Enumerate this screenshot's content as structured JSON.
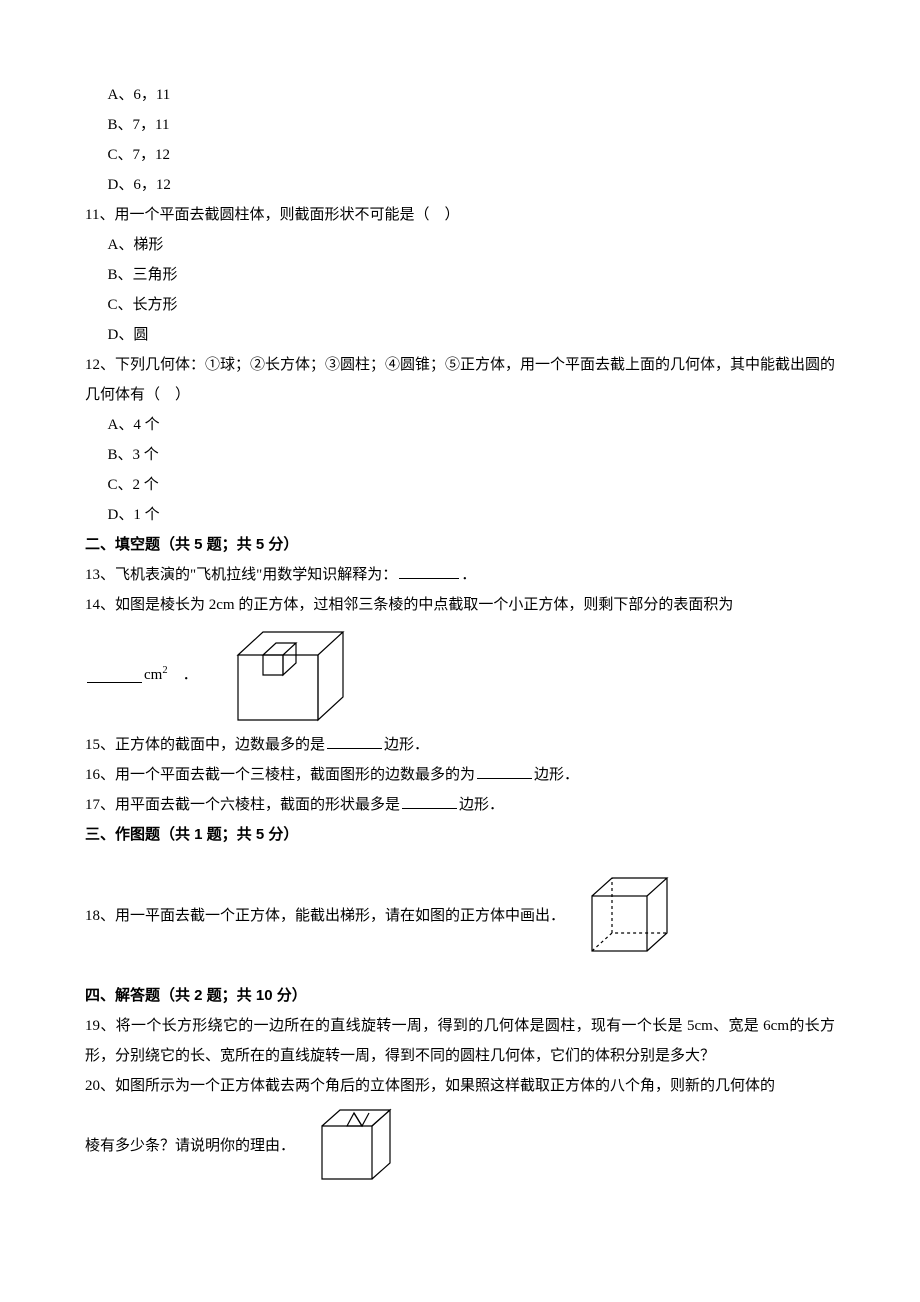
{
  "q10_options": {
    "a": "A、6，11",
    "b": "B、7，11",
    "c": "C、7，12",
    "d": "D、6，12"
  },
  "q11": {
    "text": "11、用一个平面去截圆柱体，则截面形状不可能是（　）",
    "a": "A、梯形",
    "b": "B、三角形",
    "c": "C、长方形",
    "d": "D、圆"
  },
  "q12": {
    "text": "12、下列几何体：①球；②长方体；③圆柱；④圆锥；⑤正方体，用一个平面去截上面的几何体，其中能截出圆的几何体有（　）",
    "a": "A、4 个",
    "b": "B、3 个",
    "c": "C、2 个",
    "d": "D、1 个"
  },
  "section2": "二、填空题（共 5 题；共 5 分）",
  "q13": {
    "pre": "13、飞机表演的\"飞机拉线\"用数学知识解释为：",
    "post": "．"
  },
  "q14": {
    "line1": "14、如图是棱长为 2cm 的正方体，过相邻三条棱的中点截取一个小正方体，则剩下部分的表面积为",
    "unit_post": "　．"
  },
  "q15": {
    "pre": "15、正方体的截面中，边数最多的是",
    "post": "边形．"
  },
  "q16": {
    "pre": "16、用一个平面去截一个三棱柱，截面图形的边数最多的为",
    "post": "边形．"
  },
  "q17": {
    "pre": "17、用平面去截一个六棱柱，截面的形状最多是",
    "post": "边形．"
  },
  "section3": "三、作图题（共 1 题；共 5 分）",
  "q18": {
    "text": "18、用一平面去截一个正方体，能截出梯形，请在如图的正方体中画出．"
  },
  "section4": "四、解答题（共 2 题；共 10 分）",
  "q19": {
    "text": "19、将一个长方形绕它的一边所在的直线旋转一周，得到的几何体是圆柱，现有一个长是 5cm、宽是 6cm的长方形，分别绕它的长、宽所在的直线旋转一周，得到不同的圆柱几何体，它们的体积分别是多大？"
  },
  "q20": {
    "line1": "20、如图所示为一个正方体截去两个角后的立体图形，如果照这样截取正方体的八个角，则新的几何体的",
    "line2": "棱有多少条？请说明你的理由．"
  }
}
